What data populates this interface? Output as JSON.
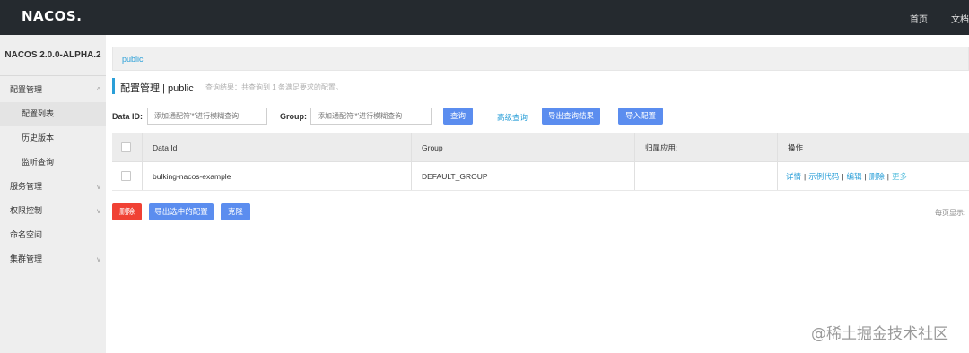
{
  "topbar": {
    "logo": "NACOS.",
    "nav": [
      "首页",
      "文档"
    ]
  },
  "sidebar": {
    "version": "NACOS 2.0.0-ALPHA.2",
    "items": [
      {
        "label": "配置管理",
        "chevron": "^"
      },
      {
        "label": "配置列表"
      },
      {
        "label": "历史版本"
      },
      {
        "label": "监听查询"
      },
      {
        "label": "服务管理",
        "chevron": "v"
      },
      {
        "label": "权限控制",
        "chevron": "v"
      },
      {
        "label": "命名空间"
      },
      {
        "label": "集群管理",
        "chevron": "v"
      }
    ]
  },
  "breadcrumb": {
    "namespace": "public"
  },
  "header": {
    "title": "配置管理 | public",
    "description": "查询结果：共查询到 1 条满足要求的配置。"
  },
  "search": {
    "dataid_label": "Data ID:",
    "dataid_placeholder": "添加通配符'*'进行模糊查询",
    "group_label": "Group:",
    "group_placeholder": "添加通配符'*'进行模糊查询",
    "query_button": "查询",
    "advanced_link": "高级查询",
    "export_results_button": "导出查询结果",
    "import_button": "导入配置"
  },
  "table": {
    "columns": [
      "Data Id",
      "Group",
      "归属应用:",
      "操作"
    ],
    "rows": [
      {
        "data_id": "bulking-nacos-example",
        "group": "DEFAULT_GROUP",
        "app": ""
      }
    ],
    "ops": {
      "detail": "详情",
      "sample": "示例代码",
      "edit": "编辑",
      "delete": "删除",
      "more": "更多"
    }
  },
  "actions": {
    "delete": "删除",
    "export_selected": "导出选中的配置",
    "clone": "克隆"
  },
  "pager": {
    "label": "每页显示:"
  },
  "watermark": "@稀土掘金技术社区",
  "colors": {
    "topbar": "#252a2f",
    "accent": "#2a9fd8",
    "primary": "#5b8def",
    "danger": "#f04134"
  }
}
